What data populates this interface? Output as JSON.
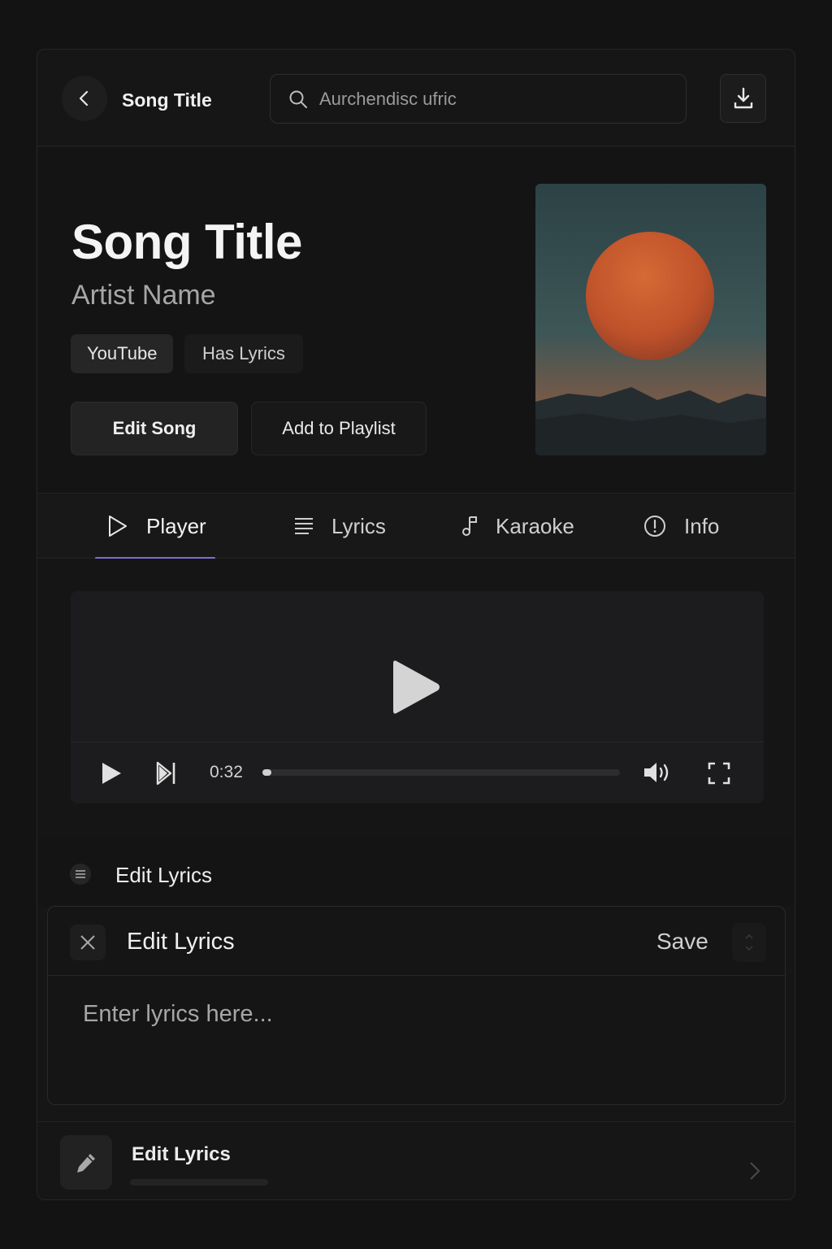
{
  "header": {
    "title": "Song Title",
    "search_placeholder": "Aurchendisc ufric"
  },
  "song": {
    "title": "Song Title",
    "artist": "Artist Name",
    "tags": [
      "YouTube",
      "Has Lyrics"
    ],
    "actions": {
      "edit": "Edit Song",
      "add_to_playlist": "Add to Playlist"
    }
  },
  "tabs": [
    {
      "label": "Player",
      "icon": "play-outline-icon",
      "active": true
    },
    {
      "label": "Lyrics",
      "icon": "lines-icon",
      "active": false
    },
    {
      "label": "Karaoke",
      "icon": "music-note-icon",
      "active": false
    },
    {
      "label": "Info",
      "icon": "info-circle-icon",
      "active": false
    }
  ],
  "player": {
    "current_time": "0:32",
    "progress": 0.02
  },
  "lyrics_section": {
    "title": "Edit Lyrics",
    "editor": {
      "title": "Edit Lyrics",
      "save_label": "Save",
      "placeholder": "Enter lyrics here..."
    },
    "bottom_item": {
      "title": "Edit Lyrics"
    }
  },
  "colors": {
    "background": "#131313",
    "accent": "#7c6fd8",
    "sun": "#c8572a"
  }
}
